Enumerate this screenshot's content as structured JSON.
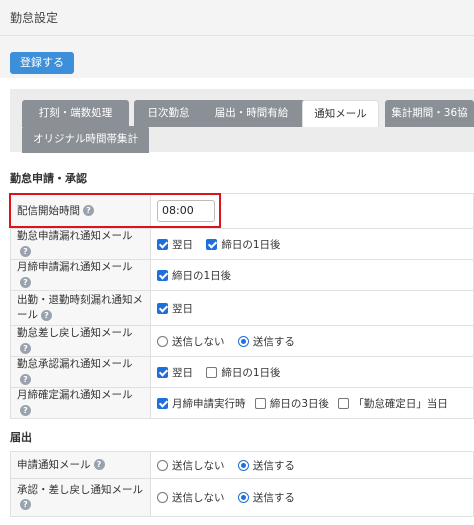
{
  "header": {
    "title": "勤怠設定"
  },
  "toolbar": {
    "register_label": "登録する"
  },
  "tabs": [
    {
      "label": "打刻・端数処理"
    },
    {
      "label": "日次勤怠"
    },
    {
      "label": "届出・時間有給"
    },
    {
      "label": "通知メール"
    },
    {
      "label": "集計期間・36協"
    },
    {
      "label": "オリジナル時間帯集計"
    }
  ],
  "section1": {
    "title": "勤怠申請・承認",
    "rows": {
      "delivery_time": {
        "label": "配信開始時間",
        "value": "08:00"
      },
      "attendance_missing": {
        "label": "勤怠申請漏れ通知メール",
        "opt1": "翌日",
        "opt2": "締日の1日後"
      },
      "monthly_missing": {
        "label": "月締申請漏れ通知メール",
        "opt1": "締日の1日後"
      },
      "clock_missing": {
        "label": "出勤・退勤時刻漏れ通知メール",
        "opt1": "翌日"
      },
      "sendback": {
        "label": "勤怠差し戻し通知メール",
        "opt1": "送信しない",
        "opt2": "送信する"
      },
      "approval_missing": {
        "label": "勤怠承認漏れ通知メール",
        "opt1": "翌日",
        "opt2": "締日の1日後"
      },
      "monthly_confirm": {
        "label": "月締確定漏れ通知メール",
        "opt1": "月締申請実行時",
        "opt2": "締日の3日後",
        "opt3": "「勤怠確定日」当日"
      }
    }
  },
  "section2": {
    "title": "届出",
    "rows": {
      "request_notice": {
        "label": "申請通知メール",
        "opt1": "送信しない",
        "opt2": "送信する"
      },
      "approve_notice": {
        "label": "承認・差し戻し通知メール",
        "opt1": "送信しない",
        "opt2": "送信する"
      }
    }
  },
  "help_glyph": "?"
}
